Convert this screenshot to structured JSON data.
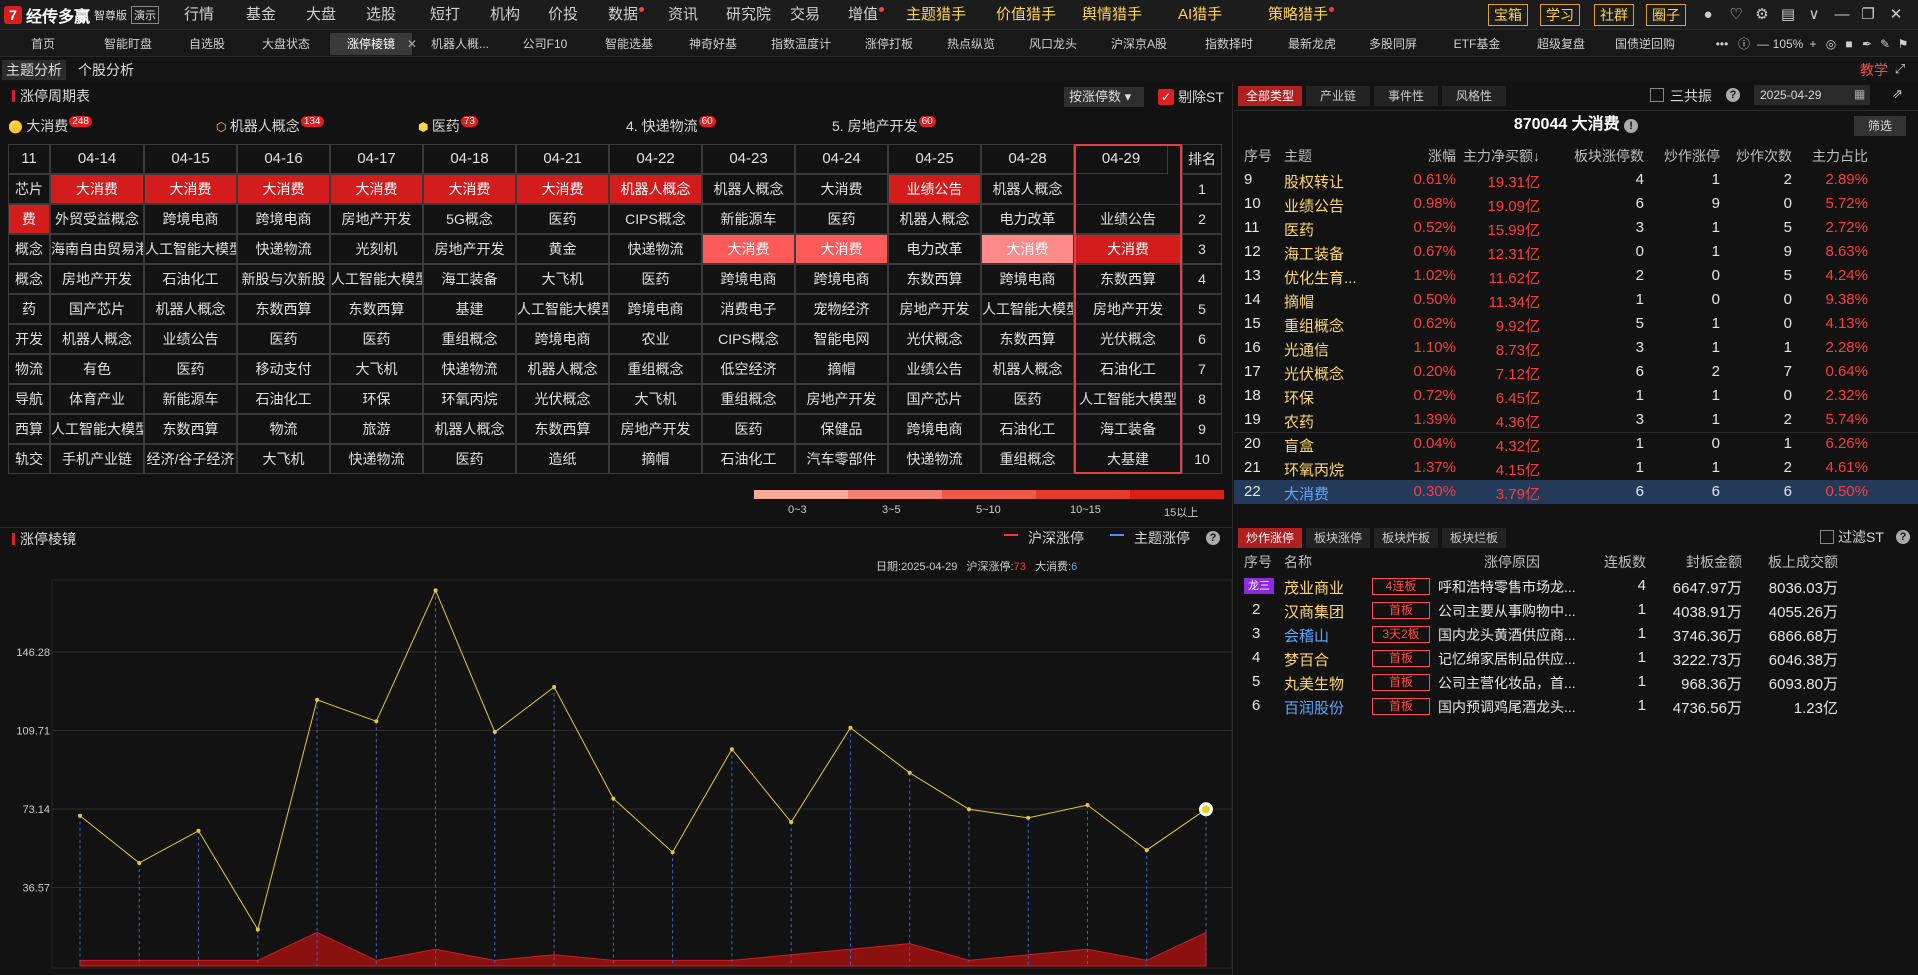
{
  "app": {
    "logo_name": "经传多赢",
    "edition": "智尊版",
    "demo": "演示"
  },
  "menu": [
    {
      "label": "行情",
      "hl": false,
      "dot": false
    },
    {
      "label": "基金",
      "hl": false,
      "dot": false
    },
    {
      "label": "大盘",
      "hl": false,
      "dot": false
    },
    {
      "label": "选股",
      "hl": false,
      "dot": false
    },
    {
      "label": "短打",
      "hl": false,
      "dot": false
    },
    {
      "label": "机构",
      "hl": false,
      "dot": false
    },
    {
      "label": "价投",
      "hl": false,
      "dot": false
    },
    {
      "label": "数据",
      "hl": false,
      "dot": true
    },
    {
      "label": "资讯",
      "hl": false,
      "dot": false
    },
    {
      "label": "研究院",
      "hl": false,
      "dot": false
    },
    {
      "label": "交易",
      "hl": false,
      "dot": false
    },
    {
      "label": "增值",
      "hl": false,
      "dot": true
    },
    {
      "label": "主题猎手",
      "hl": true,
      "dot": false
    },
    {
      "label": "价值猎手",
      "hl": true,
      "dot": false
    },
    {
      "label": "舆情猎手",
      "hl": true,
      "dot": false
    },
    {
      "label": "AI猎手",
      "hl": true,
      "dot": false
    },
    {
      "label": "策略猎手",
      "hl": true,
      "dot": true
    }
  ],
  "top_buttons": [
    "宝箱",
    "学习",
    "社群",
    "圈子"
  ],
  "tabs": [
    "首页",
    "智能盯盘",
    "自选股",
    "大盘状态",
    "涨停棱镜",
    "机器人概...",
    "公司F10",
    "智能选基",
    "神奇好基",
    "指数温度计",
    "涨停打板",
    "热点纵览",
    "风口龙头",
    "沪深京A股",
    "指数择时",
    "最新龙虎",
    "多股同屏",
    "ETF基金",
    "超级复盘",
    "国债逆回购"
  ],
  "zoom": "105%",
  "subtabs": [
    "主题分析",
    "个股分析"
  ],
  "teach": "教学",
  "cycle": {
    "title": "涨停周期表",
    "sort_label": "按涨停数",
    "exclude_st": "剔除ST",
    "top": [
      {
        "name": "大消费",
        "count": "248",
        "icon": "🟡"
      },
      {
        "name": "机器人概念",
        "count": "134",
        "icon": "⬡"
      },
      {
        "name": "医药",
        "count": "73",
        "icon": "⬢"
      },
      {
        "name": "4. 快递物流",
        "count": "60",
        "icon": ""
      },
      {
        "name": "5. 房地产开发",
        "count": "60",
        "icon": ""
      }
    ],
    "dates": [
      "11",
      "04-14",
      "04-15",
      "04-16",
      "04-17",
      "04-18",
      "04-21",
      "04-22",
      "04-23",
      "04-24",
      "04-25",
      "04-28",
      "04-29"
    ],
    "rank_header": "排名",
    "rows": [
      [
        "芯片",
        "大消费",
        "大消费",
        "大消费",
        "大消费",
        "大消费",
        "大消费",
        "机器人概念",
        "机器人概念",
        "大消费",
        "业绩公告",
        "机器人概念"
      ],
      [
        "费",
        "外贸受益概念",
        "跨境电商",
        "跨境电商",
        "房地产开发",
        "5G概念",
        "医药",
        "CIPS概念",
        "新能源车",
        "医药",
        "机器人概念",
        "电力改革",
        "业绩公告"
      ],
      [
        "概念",
        "海南自由贸易港",
        "人工智能大模型",
        "快递物流",
        "光刻机",
        "房地产开发",
        "黄金",
        "快递物流",
        "大消费",
        "大消费",
        "电力改革",
        "大消费",
        "大消费"
      ],
      [
        "概念",
        "房地产开发",
        "石油化工",
        "新股与次新股",
        "人工智能大模型",
        "海工装备",
        "大飞机",
        "医药",
        "跨境电商",
        "跨境电商",
        "东数西算",
        "跨境电商",
        "东数西算"
      ],
      [
        "药",
        "国产芯片",
        "机器人概念",
        "东数西算",
        "东数西算",
        "基建",
        "人工智能大模型",
        "跨境电商",
        "消费电子",
        "宠物经济",
        "房地产开发",
        "人工智能大模型",
        "房地产开发"
      ],
      [
        "开发",
        "机器人概念",
        "业绩公告",
        "医药",
        "医药",
        "重组概念",
        "跨境电商",
        "农业",
        "CIPS概念",
        "智能电网",
        "光伏概念",
        "东数西算",
        "光伏概念"
      ],
      [
        "物流",
        "有色",
        "医药",
        "移动支付",
        "大飞机",
        "快递物流",
        "机器人概念",
        "重组概念",
        "低空经济",
        "摘帽",
        "业绩公告",
        "机器人概念",
        "石油化工"
      ],
      [
        "导航",
        "体育产业",
        "新能源车",
        "石油化工",
        "环保",
        "环氧丙烷",
        "光伏概念",
        "大飞机",
        "重组概念",
        "房地产开发",
        "国产芯片",
        "医药",
        "人工智能大模型"
      ],
      [
        "西算",
        "人工智能大模型",
        "东数西算",
        "物流",
        "旅游",
        "机器人概念",
        "东数西算",
        "房地产开发",
        "医药",
        "保健品",
        "跨境电商",
        "石油化工",
        "海工装备"
      ],
      [
        "轨交",
        "手机产业链",
        "经济/谷子经济",
        "大飞机",
        "快递物流",
        "医药",
        "造纸",
        "摘帽",
        "石油化工",
        "汽车零部件",
        "快递物流",
        "重组概念",
        "大基建"
      ]
    ],
    "heat": [
      [
        "",
        "d",
        "d",
        "d",
        "d",
        "d",
        "d",
        "d",
        "",
        "",
        "d",
        "",
        ""
      ],
      [
        "d",
        "",
        "",
        "",
        "",
        "",
        "",
        "",
        "",
        "",
        "",
        "",
        ""
      ],
      [
        "",
        "",
        "",
        "",
        "",
        "",
        "",
        "",
        "m",
        "m",
        "",
        "l",
        "d"
      ],
      [
        "",
        "",
        "",
        "",
        "",
        "",
        "",
        "",
        "",
        "",
        "",
        "",
        ""
      ],
      [
        "",
        "",
        "",
        "",
        "",
        "",
        "",
        "",
        "",
        "",
        "",
        "",
        ""
      ],
      [
        "",
        "",
        "",
        "",
        "",
        "",
        "",
        "",
        "",
        "",
        "",
        "",
        ""
      ],
      [
        "",
        "",
        "",
        "",
        "",
        "",
        "",
        "",
        "",
        "",
        "",
        "",
        ""
      ],
      [
        "",
        "",
        "",
        "",
        "",
        "",
        "",
        "",
        "",
        "",
        "",
        "",
        ""
      ],
      [
        "",
        "",
        "",
        "",
        "",
        "",
        "",
        "",
        "",
        "",
        "",
        "",
        ""
      ],
      [
        "",
        "",
        "",
        "",
        "",
        "",
        "",
        "",
        "",
        "",
        "",
        "",
        ""
      ]
    ],
    "heat_colors": {
      "d": "#d31d1d",
      "m": "#ff5a5a",
      "l": "#ff8a8a"
    },
    "legend": [
      "0~3",
      "3~5",
      "5~10",
      "10~15",
      "15以上"
    ],
    "legend_colors": [
      "#f8a89a",
      "#f38070",
      "#ec5a4a",
      "#e43a2c",
      "#d8201a"
    ]
  },
  "prism": {
    "title": "涨停棱镜",
    "legend_market": "沪深涨停",
    "legend_theme": "主题涨停",
    "info_date_label": "日期:",
    "info_date": "2025-04-29",
    "info_market_label": "沪深涨停:",
    "info_market": "73",
    "info_theme_label": "大消费:",
    "info_theme": "6",
    "yticks": [
      "146.28",
      "109.71",
      "73.14",
      "36.57"
    ]
  },
  "chart_data": {
    "type": "line",
    "title": "涨停棱镜",
    "yticks": [
      36.57,
      73.14,
      109.71,
      146.28
    ],
    "series": [
      {
        "name": "沪深涨停",
        "values": [
          70,
          48,
          63,
          17,
          124,
          114,
          175,
          109,
          130,
          78,
          53,
          101,
          67,
          111,
          90,
          73,
          69,
          75,
          54,
          73
        ]
      },
      {
        "name": "主题涨停",
        "values": [
          1,
          1,
          1,
          1,
          6,
          1,
          3,
          1,
          2,
          1,
          1,
          1,
          2,
          3,
          4,
          1,
          2,
          3,
          1,
          6
        ]
      }
    ]
  },
  "right": {
    "tabs": [
      "全部类型",
      "产业链",
      "事件性",
      "风格性"
    ],
    "sanfenzhen": "三共振",
    "date": "2025-04-29",
    "title": "870044 大消费",
    "filter": "筛选",
    "headers": [
      "序号",
      "主题",
      "涨幅",
      "主力净买额↓",
      "板块涨停数",
      "炒作涨停",
      "炒作次数",
      "主力占比"
    ],
    "rows": [
      [
        "9",
        "股权转让",
        "0.61%",
        "19.31亿",
        "4",
        "1",
        "2",
        "2.89%"
      ],
      [
        "10",
        "业绩公告",
        "0.98%",
        "19.09亿",
        "6",
        "9",
        "0",
        "5.72%"
      ],
      [
        "11",
        "医药",
        "0.52%",
        "15.99亿",
        "3",
        "1",
        "5",
        "2.72%"
      ],
      [
        "12",
        "海工装备",
        "0.67%",
        "12.31亿",
        "0",
        "1",
        "9",
        "8.63%"
      ],
      [
        "13",
        "优化生育...",
        "1.02%",
        "11.62亿",
        "2",
        "0",
        "5",
        "4.24%"
      ],
      [
        "14",
        "摘帽",
        "0.50%",
        "11.34亿",
        "1",
        "0",
        "0",
        "9.38%"
      ],
      [
        "15",
        "重组概念",
        "0.62%",
        "9.92亿",
        "5",
        "1",
        "0",
        "4.13%"
      ],
      [
        "16",
        "光通信",
        "1.10%",
        "8.73亿",
        "3",
        "1",
        "1",
        "2.28%"
      ],
      [
        "17",
        "光伏概念",
        "0.20%",
        "7.12亿",
        "6",
        "2",
        "7",
        "0.64%"
      ],
      [
        "18",
        "环保",
        "0.72%",
        "6.45亿",
        "1",
        "1",
        "0",
        "2.32%"
      ],
      [
        "19",
        "农药",
        "1.39%",
        "4.36亿",
        "3",
        "1",
        "2",
        "5.74%"
      ],
      [
        "20",
        "盲盒",
        "0.04%",
        "4.32亿",
        "1",
        "0",
        "1",
        "6.26%"
      ],
      [
        "21",
        "环氧丙烷",
        "1.37%",
        "4.15亿",
        "1",
        "1",
        "2",
        "4.61%"
      ],
      [
        "22",
        "大消费",
        "0.30%",
        "3.79亿",
        "6",
        "6",
        "6",
        "0.50%"
      ]
    ],
    "bottom_tabs": [
      "炒作涨停",
      "板块涨停",
      "板块炸板",
      "板块烂板"
    ],
    "filter_st": "过滤ST",
    "bheaders": [
      "序号",
      "名称",
      "涨停原因",
      "连板数",
      "封板金额",
      "板上成交额"
    ],
    "brows": [
      {
        "no": "龙三",
        "name": "茂业商业",
        "tag": "4连板",
        "reason": "呼和浩特零售市场龙...",
        "lb": "4",
        "amt": "6647.97万",
        "vol": "8036.03万",
        "blue": false
      },
      {
        "no": "2",
        "name": "汉商集团",
        "tag": "首板",
        "reason": "公司主要从事购物中...",
        "lb": "1",
        "amt": "4038.91万",
        "vol": "4055.26万",
        "blue": false
      },
      {
        "no": "3",
        "name": "会稽山",
        "tag": "3天2板",
        "reason": "国内龙头黄酒供应商...",
        "lb": "1",
        "amt": "3746.36万",
        "vol": "6866.68万",
        "blue": true
      },
      {
        "no": "4",
        "name": "梦百合",
        "tag": "首板",
        "reason": "记忆绵家居制品供应...",
        "lb": "1",
        "amt": "3222.73万",
        "vol": "6046.38万",
        "blue": false
      },
      {
        "no": "5",
        "name": "丸美生物",
        "tag": "首板",
        "reason": "公司主营化妆品，首...",
        "lb": "1",
        "amt": "968.36万",
        "vol": "6093.80万",
        "blue": false
      },
      {
        "no": "6",
        "name": "百润股份",
        "tag": "首板",
        "reason": "国内预调鸡尾酒龙头...",
        "lb": "1",
        "amt": "4736.56万",
        "vol": "1.23亿",
        "blue": true
      }
    ]
  }
}
